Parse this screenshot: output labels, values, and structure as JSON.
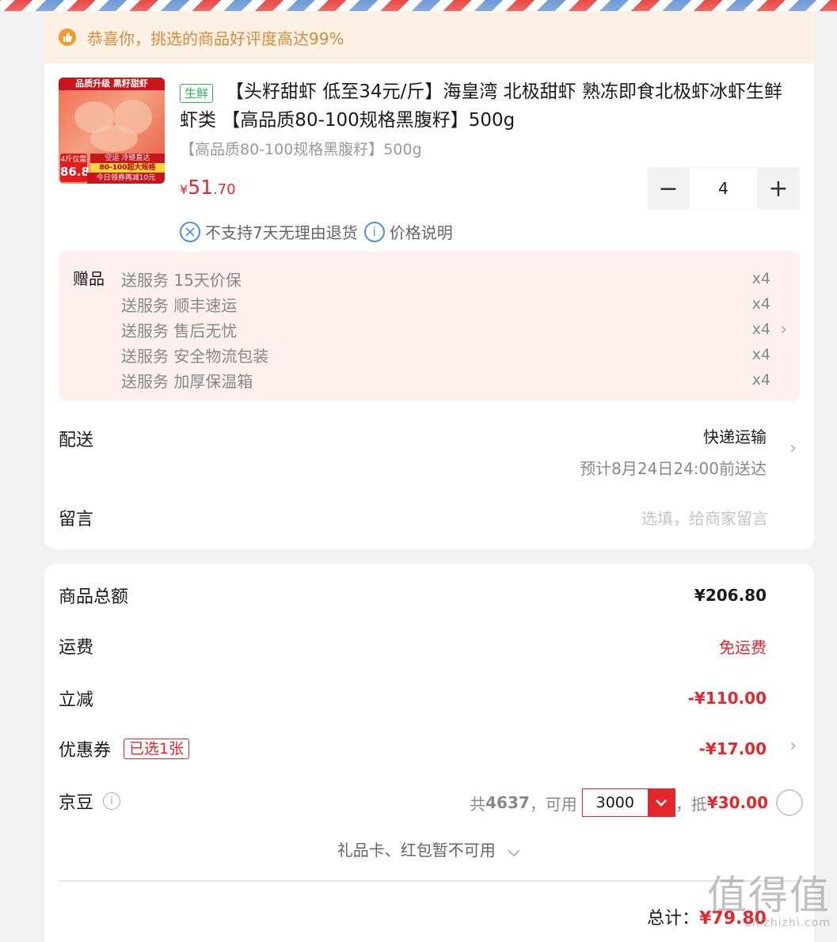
{
  "banner": {
    "text": "恭喜你，挑选的商品好评度高达99%"
  },
  "product": {
    "image_texts": {
      "top": "品质升级 黑籽甜虾",
      "badge_line": "4斤仅需",
      "badge_price": "86.8",
      "line1": "空运 冷链直达",
      "line2": "80-100超大规格",
      "line3": "今日领券再减10元"
    },
    "fresh_tag": "生鲜",
    "title": "【头籽甜虾 低至34元/斤】海皇湾 北极甜虾 熟冻即食北极虾冰虾生鲜虾类 【高品质80-100规格黑腹籽】500g",
    "spec": "【高品质80-100规格黑腹籽】500g",
    "price_symbol": "¥",
    "price_int": "51",
    "price_dec": ".70",
    "qty_minus": "−",
    "qty_value": "4",
    "qty_plus": "+",
    "policy_no_return": "不支持7天无理由退货",
    "policy_price_note": "价格说明"
  },
  "gifts": {
    "label": "赠品",
    "items": [
      {
        "name": "送服务 15天价保",
        "qty": "x4"
      },
      {
        "name": "送服务 顺丰速运",
        "qty": "x4"
      },
      {
        "name": "送服务 售后无忧",
        "qty": "x4"
      },
      {
        "name": "送服务 安全物流包装",
        "qty": "x4"
      },
      {
        "name": "送服务 加厚保温箱",
        "qty": "x4"
      }
    ]
  },
  "delivery": {
    "label": "配送",
    "method": "快递运输",
    "eta": "预计8月24日24:00前送达"
  },
  "memo": {
    "label": "留言",
    "placeholder": "选填，给商家留言"
  },
  "summary": {
    "goods_total_label": "商品总额",
    "goods_total": "¥206.80",
    "freight_label": "运费",
    "freight": "免运费",
    "discount_label": "立减",
    "discount": "-¥110.00",
    "coupon_label": "优惠券",
    "coupon_tag": "已选1张",
    "coupon": "-¥17.00",
    "beans_label": "京豆",
    "beans_total_prefix": "共",
    "beans_total": "4637",
    "beans_usable": "，可用",
    "beans_selected": "3000",
    "beans_deduct_prefix": "，抵",
    "beans_deduct": "¥30.00",
    "giftcard_text": "礼品卡、红包暂不可用",
    "total_label": "总计：",
    "total": "¥79.80"
  },
  "watermark": {
    "big": "值得值",
    "small": "zhizhizhi.com"
  },
  "colors": {
    "accent_red": "#e4262d",
    "fresh_green": "#2bb45a",
    "banner_bg": "#fdf1e6",
    "gift_bg": "#fdf0ee"
  }
}
